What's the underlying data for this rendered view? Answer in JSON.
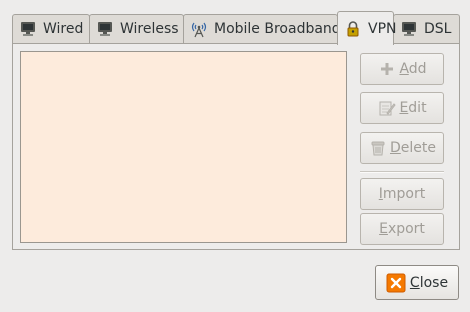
{
  "tabs": [
    {
      "label": "Wired",
      "icon": "network-wired-icon"
    },
    {
      "label": "Wireless",
      "icon": "network-wireless-icon"
    },
    {
      "label": "Mobile Broadband",
      "icon": "antenna-icon"
    },
    {
      "label": "VPN",
      "icon": "lock-icon",
      "active": true
    },
    {
      "label": "DSL",
      "icon": "network-wired-icon"
    }
  ],
  "buttons": {
    "add": {
      "mnemonic": "A",
      "rest": "dd"
    },
    "edit": {
      "mnemonic": "E",
      "rest": "dit"
    },
    "delete": {
      "mnemonic": "D",
      "rest": "elete"
    },
    "import": {
      "mnemonic": "I",
      "rest": "mport"
    },
    "export": {
      "mnemonic": "E",
      "rest": "xport"
    },
    "close": {
      "mnemonic": "C",
      "rest": "lose"
    }
  },
  "colors": {
    "list_background": "#fdebdc",
    "disabled_text": "#a09d97",
    "close_icon": "#f57900"
  }
}
